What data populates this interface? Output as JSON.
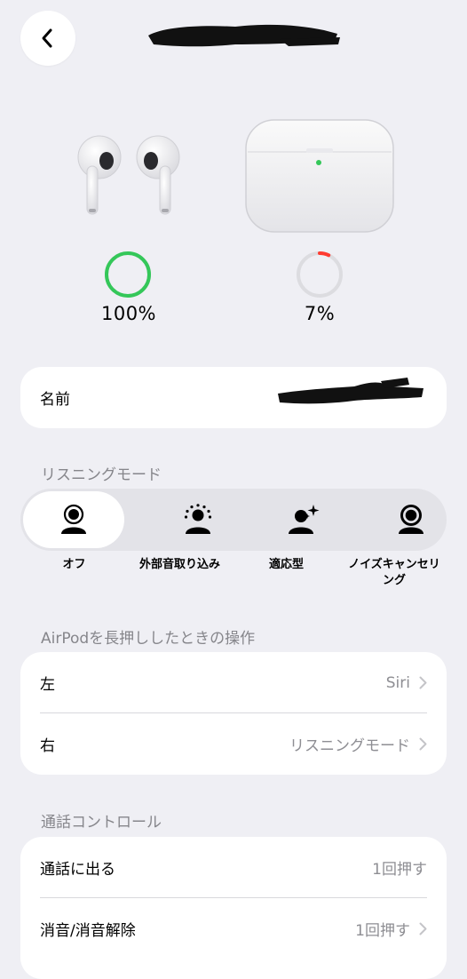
{
  "header": {
    "back_icon": "chevron-left-icon"
  },
  "battery": {
    "earbuds": {
      "percent_label": "100%",
      "level": 1.0,
      "color": "#34c759"
    },
    "case": {
      "percent_label": "7%",
      "level": 0.07,
      "color": "#ff3b30"
    }
  },
  "name_row": {
    "label": "名前"
  },
  "listening_mode": {
    "section_label": "リスニングモード",
    "options": [
      {
        "label": "オフ",
        "icon": "person-off-icon",
        "selected": true
      },
      {
        "label": "外部音取り込み",
        "icon": "person-transparency-icon",
        "selected": false
      },
      {
        "label": "適応型",
        "icon": "person-adaptive-icon",
        "selected": false
      },
      {
        "label": "ノイズキャンセリング",
        "icon": "person-noise-cancel-icon",
        "selected": false
      }
    ]
  },
  "press_hold": {
    "section_label": "AirPodを長押ししたときの操作",
    "rows": [
      {
        "label": "左",
        "value": "Siri"
      },
      {
        "label": "右",
        "value": "リスニングモード"
      }
    ]
  },
  "call_control": {
    "section_label": "通話コントロール",
    "rows": [
      {
        "label": "通話に出る",
        "value": "1回押す"
      },
      {
        "label": "消音/消音解除",
        "value": "1回押す"
      }
    ]
  }
}
